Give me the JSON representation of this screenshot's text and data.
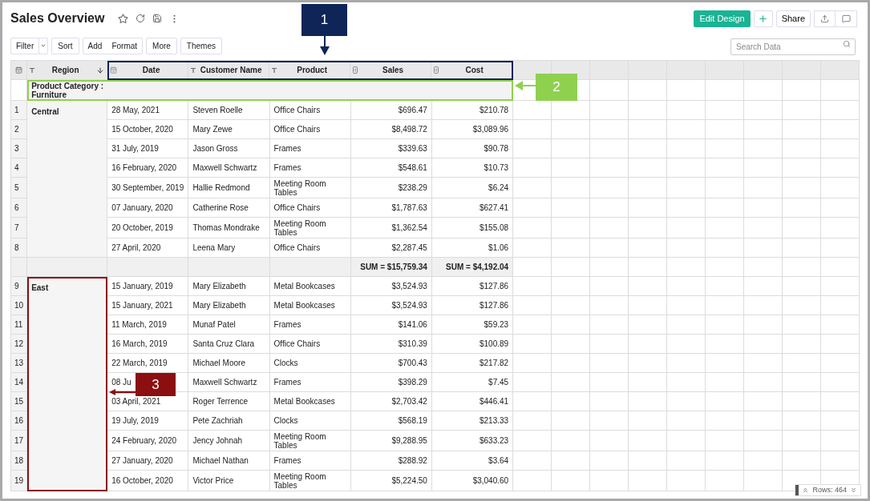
{
  "title": "Sales Overview",
  "header_buttons": {
    "edit": "Edit Design",
    "share": "Share"
  },
  "toolbar": [
    "Filter",
    "Sort",
    "Add",
    "Format",
    "More",
    "Themes"
  ],
  "search": {
    "placeholder": "Search Data"
  },
  "columns": [
    {
      "label": "Region",
      "kind": "text",
      "sorted": true
    },
    {
      "label": "Date",
      "kind": "date",
      "sorted": false
    },
    {
      "label": "Customer Name",
      "kind": "text",
      "sorted": false
    },
    {
      "label": "Product",
      "kind": "text",
      "sorted": false
    },
    {
      "label": "Sales",
      "kind": "number",
      "sorted": false
    },
    {
      "label": "Cost",
      "kind": "number",
      "sorted": false
    }
  ],
  "category": {
    "label": "Product Category :",
    "value": "Furniture"
  },
  "groups": [
    {
      "region": "Central",
      "highlighted": false,
      "rows": [
        {
          "num": "1",
          "date": "28 May, 2021",
          "customer": "Steven Roelle",
          "product": "Office Chairs",
          "sales": "$696.47",
          "cost": "$210.78"
        },
        {
          "num": "2",
          "date": "15 October, 2020",
          "customer": "Mary Zewe",
          "product": "Office Chairs",
          "sales": "$8,498.72",
          "cost": "$3,089.96"
        },
        {
          "num": "3",
          "date": "31 July, 2019",
          "customer": "Jason Gross",
          "product": "Frames",
          "sales": "$339.63",
          "cost": "$90.78"
        },
        {
          "num": "4",
          "date": "16 February, 2020",
          "customer": "Maxwell Schwartz",
          "product": "Frames",
          "sales": "$548.61",
          "cost": "$10.73"
        },
        {
          "num": "5",
          "date": "30 September, 2019",
          "customer": "Hallie Redmond",
          "product": "Meeting Room Tables",
          "sales": "$238.29",
          "cost": "$6.24"
        },
        {
          "num": "6",
          "date": "07 January, 2020",
          "customer": "Catherine Rose",
          "product": "Office Chairs",
          "sales": "$1,787.63",
          "cost": "$627.41"
        },
        {
          "num": "7",
          "date": "20 October, 2019",
          "customer": "Thomas Mondrake",
          "product": "Meeting Room Tables",
          "sales": "$1,362.54",
          "cost": "$155.08"
        },
        {
          "num": "8",
          "date": "27 April, 2020",
          "customer": "Leena Mary",
          "product": "Office Chairs",
          "sales": "$2,287.45",
          "cost": "$1.06"
        }
      ],
      "sum": {
        "sales": "SUM = $15,759.34",
        "cost": "SUM = $4,192.04"
      }
    },
    {
      "region": "East",
      "highlighted": true,
      "rows": [
        {
          "num": "9",
          "date": "15 January, 2019",
          "customer": "Mary Elizabeth",
          "product": "Metal Bookcases",
          "sales": "$3,524.93",
          "cost": "$127.86"
        },
        {
          "num": "10",
          "date": "15 January, 2021",
          "customer": "Mary Elizabeth",
          "product": "Metal Bookcases",
          "sales": "$3,524.93",
          "cost": "$127.86"
        },
        {
          "num": "11",
          "date": "11 March, 2019",
          "customer": "Munaf Patel",
          "product": "Frames",
          "sales": "$141.06",
          "cost": "$59.23"
        },
        {
          "num": "12",
          "date": "16 March, 2019",
          "customer": "Santa Cruz Clara",
          "product": "Office Chairs",
          "sales": "$310.39",
          "cost": "$100.89"
        },
        {
          "num": "13",
          "date": "22 March, 2019",
          "customer": "Michael Moore",
          "product": "Clocks",
          "sales": "$700.43",
          "cost": "$217.82"
        },
        {
          "num": "14",
          "date": "08 Ju",
          "customer": "Maxwell Schwartz",
          "product": "Frames",
          "sales": "$398.29",
          "cost": "$7.45"
        },
        {
          "num": "15",
          "date": "03 April, 2021",
          "customer": "Roger Terrence",
          "product": "Metal Bookcases",
          "sales": "$2,703.42",
          "cost": "$446.41"
        },
        {
          "num": "16",
          "date": "19 July, 2019",
          "customer": "Pete Zachriah",
          "product": "Clocks",
          "sales": "$568.19",
          "cost": "$213.33"
        },
        {
          "num": "17",
          "date": "24 February, 2020",
          "customer": "Jency Johnah",
          "product": "Meeting Room Tables",
          "sales": "$9,288.95",
          "cost": "$633.23"
        },
        {
          "num": "18",
          "date": "27 January, 2020",
          "customer": "Michael Nathan",
          "product": "Frames",
          "sales": "$288.92",
          "cost": "$3.64"
        },
        {
          "num": "19",
          "date": "16 October, 2020",
          "customer": "Victor Price",
          "product": "Meeting Room Tables",
          "sales": "$5,224.50",
          "cost": "$3,040.60"
        }
      ]
    }
  ],
  "rows_count": "Rows: 464",
  "callouts": [
    {
      "label": "1",
      "color": "#0f2557"
    },
    {
      "label": "2",
      "color": "#8fd14f"
    },
    {
      "label": "3",
      "color": "#8b0e10"
    }
  ]
}
